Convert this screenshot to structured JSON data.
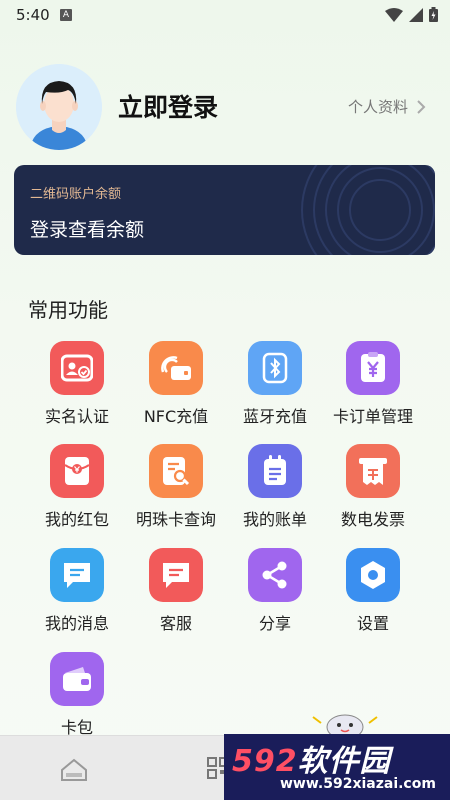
{
  "status_bar": {
    "time": "5:40",
    "badge": "A"
  },
  "profile": {
    "login": "立即登录",
    "profile_link": "个人资料"
  },
  "balance": {
    "label": "二维码账户余额",
    "value": "登录查看余额"
  },
  "functions": {
    "title": "常用功能",
    "items": [
      {
        "label": "实名认证",
        "icon": "id-card-icon",
        "color": "#f25a5a"
      },
      {
        "label": "NFC充值",
        "icon": "nfc-card-icon",
        "color": "#f98a4b"
      },
      {
        "label": "蓝牙充值",
        "icon": "bluetooth-icon",
        "color": "#5fa5f5"
      },
      {
        "label": "卡订单管理",
        "icon": "yuan-order-icon",
        "color": "#a066ee"
      },
      {
        "label": "我的红包",
        "icon": "red-envelope-icon",
        "color": "#f25a5a"
      },
      {
        "label": "明珠卡查询",
        "icon": "search-card-icon",
        "color": "#f98a4b"
      },
      {
        "label": "我的账单",
        "icon": "bill-icon",
        "color": "#6a6fe8"
      },
      {
        "label": "数电发票",
        "icon": "invoice-icon",
        "color": "#f2705a"
      },
      {
        "label": "我的消息",
        "icon": "message-icon",
        "color": "#3aa7ee"
      },
      {
        "label": "客服",
        "icon": "customer-service-icon",
        "color": "#f25a5a"
      },
      {
        "label": "分享",
        "icon": "share-icon",
        "color": "#a066ee"
      },
      {
        "label": "设置",
        "icon": "settings-icon",
        "color": "#3a8ff0"
      },
      {
        "label": "卡包",
        "icon": "wallet-icon",
        "color": "#a066ee"
      }
    ]
  },
  "watermark": {
    "brand_num": "592",
    "brand_text": "软件园",
    "url": "www.592xiazai.com"
  },
  "colors": {
    "card_bg": "#1f2a4a",
    "accent_gold": "#e2b893",
    "watermark_bg": "#1a1d5a",
    "watermark_red": "#ff4f64"
  }
}
